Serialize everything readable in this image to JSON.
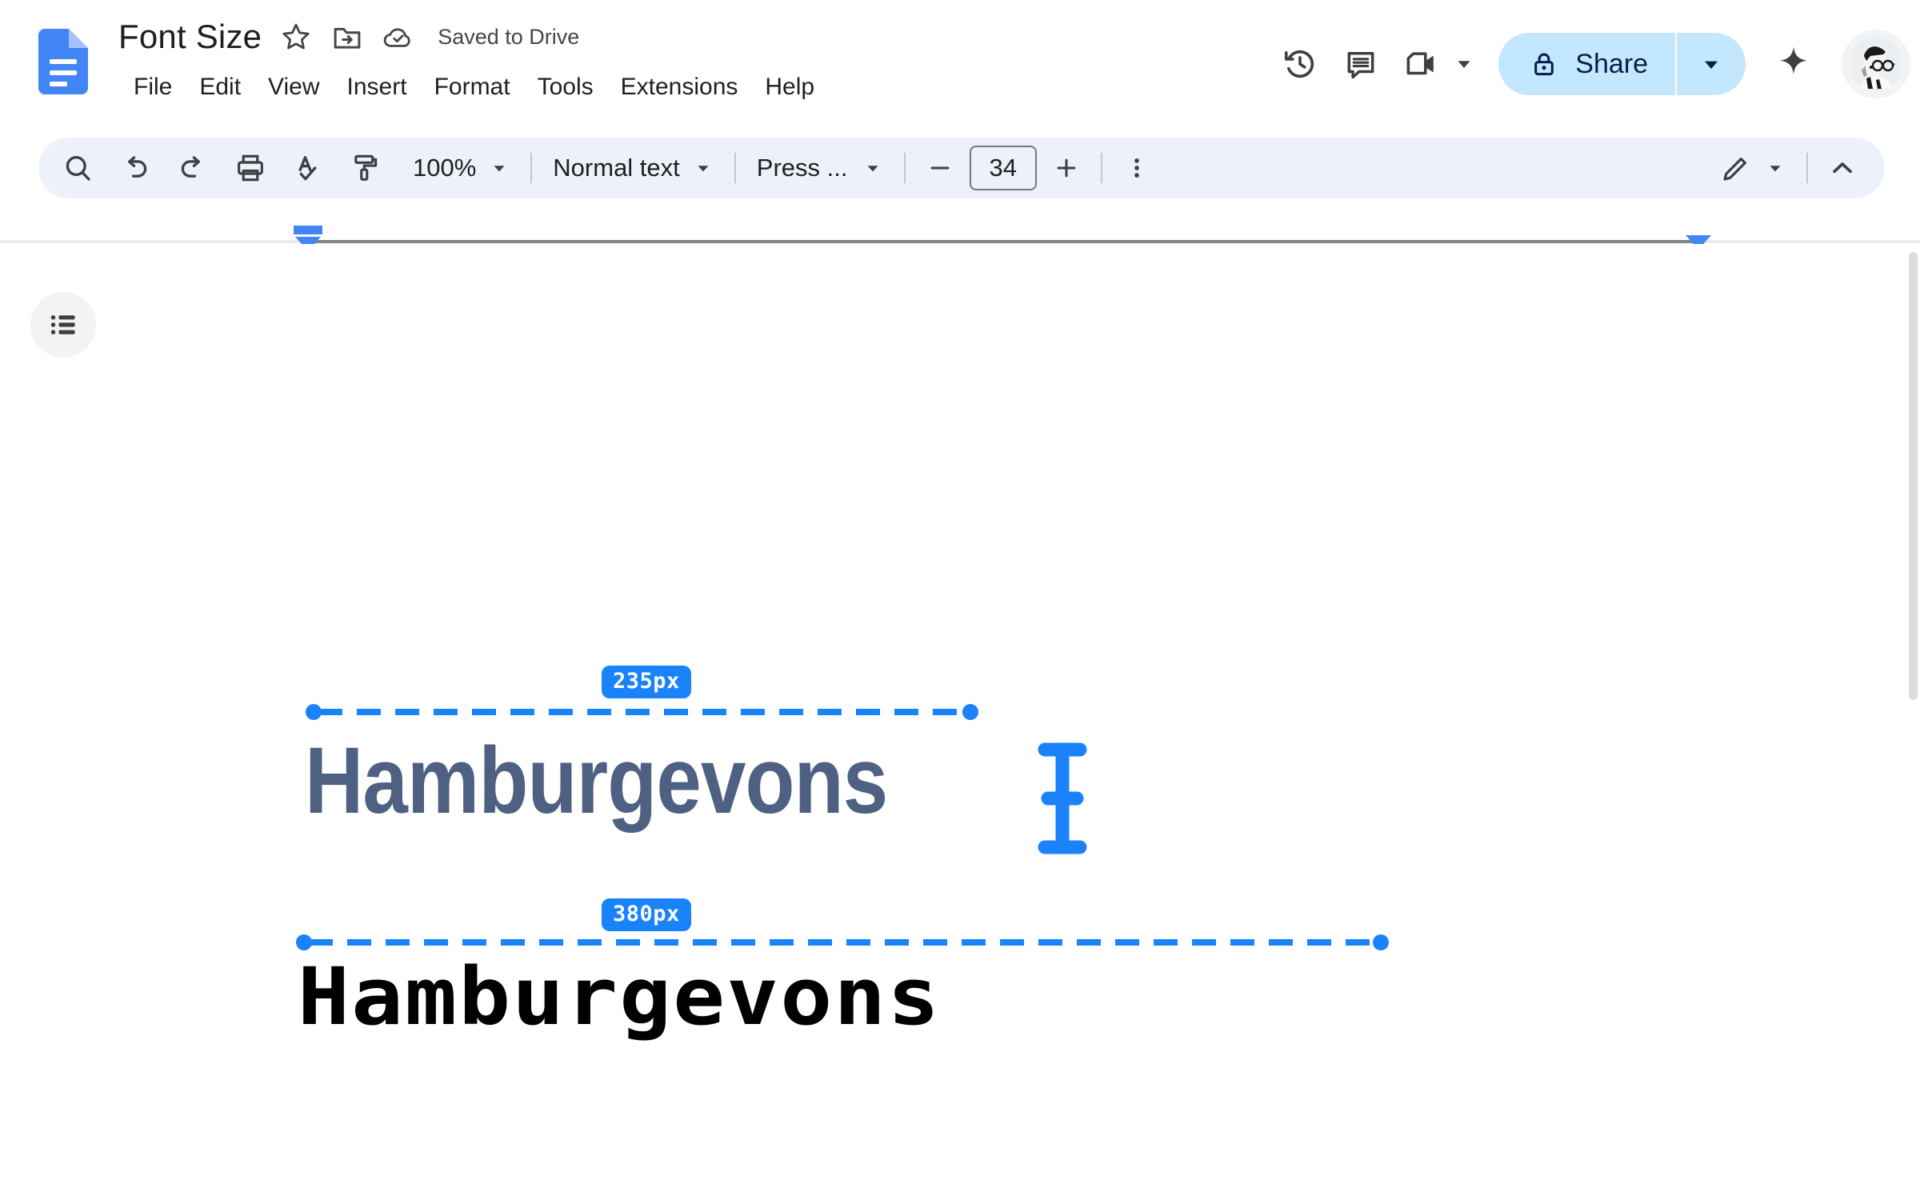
{
  "app": {
    "logo_icon": "google-docs-logo",
    "document_title": "Font Size",
    "save_status": "Saved to Drive",
    "star_icon": "star-icon",
    "move_icon": "move-to-folder-icon",
    "cloud_icon": "cloud-saved-icon"
  },
  "menu": {
    "items": [
      {
        "label": "File"
      },
      {
        "label": "Edit"
      },
      {
        "label": "View"
      },
      {
        "label": "Insert"
      },
      {
        "label": "Format"
      },
      {
        "label": "Tools"
      },
      {
        "label": "Extensions"
      },
      {
        "label": "Help"
      }
    ]
  },
  "top_right": {
    "history_icon": "version-history-icon",
    "comment_icon": "comment-icon",
    "meet_icon": "google-meet-camera-icon",
    "meet_arrow_icon": "chevron-down-icon",
    "share": {
      "lock_icon": "lock-icon",
      "label": "Share",
      "arrow_icon": "chevron-down-icon"
    },
    "gemini_icon": "gemini-sparkle-icon",
    "avatar_icon": "user-avatar"
  },
  "toolbar": {
    "search_icon": "search-icon",
    "undo_icon": "undo-icon",
    "redo_icon": "redo-icon",
    "print_icon": "print-icon",
    "spellcheck_icon": "spellcheck-icon",
    "paint_format_icon": "paint-format-icon",
    "zoom_value": "100%",
    "zoom_arrow_icon": "chevron-down-icon",
    "style_value": "Normal text",
    "style_arrow_icon": "chevron-down-icon",
    "font_value": "Press ...",
    "font_arrow_icon": "chevron-down-icon",
    "decrease_font_icon": "minus-icon",
    "font_size_value": "34",
    "increase_font_icon": "plus-icon",
    "more_options_icon": "more-vertical-icon",
    "edit_mode_icon": "pencil-icon",
    "edit_mode_arrow_icon": "chevron-down-icon",
    "collapse_icon": "chevron-up-icon"
  },
  "ruler": {
    "left_indent_marker": "left-indent-marker",
    "right_indent_marker": "right-indent-marker"
  },
  "document": {
    "outline_icon": "document-outline-icon",
    "text_cursor_icon": "i-beam-text-cursor",
    "measurements": [
      {
        "label": "235px",
        "sample_text": "Hamburgevons"
      },
      {
        "label": "380px",
        "sample_text": "Hamburgevons"
      }
    ]
  },
  "colors": {
    "accent_blue": "#1a82fb",
    "share_bg": "#c2e7ff",
    "toolbar_bg": "#edf2fa",
    "sample_one_color": "#4e6183",
    "sample_two_color": "#000000"
  }
}
